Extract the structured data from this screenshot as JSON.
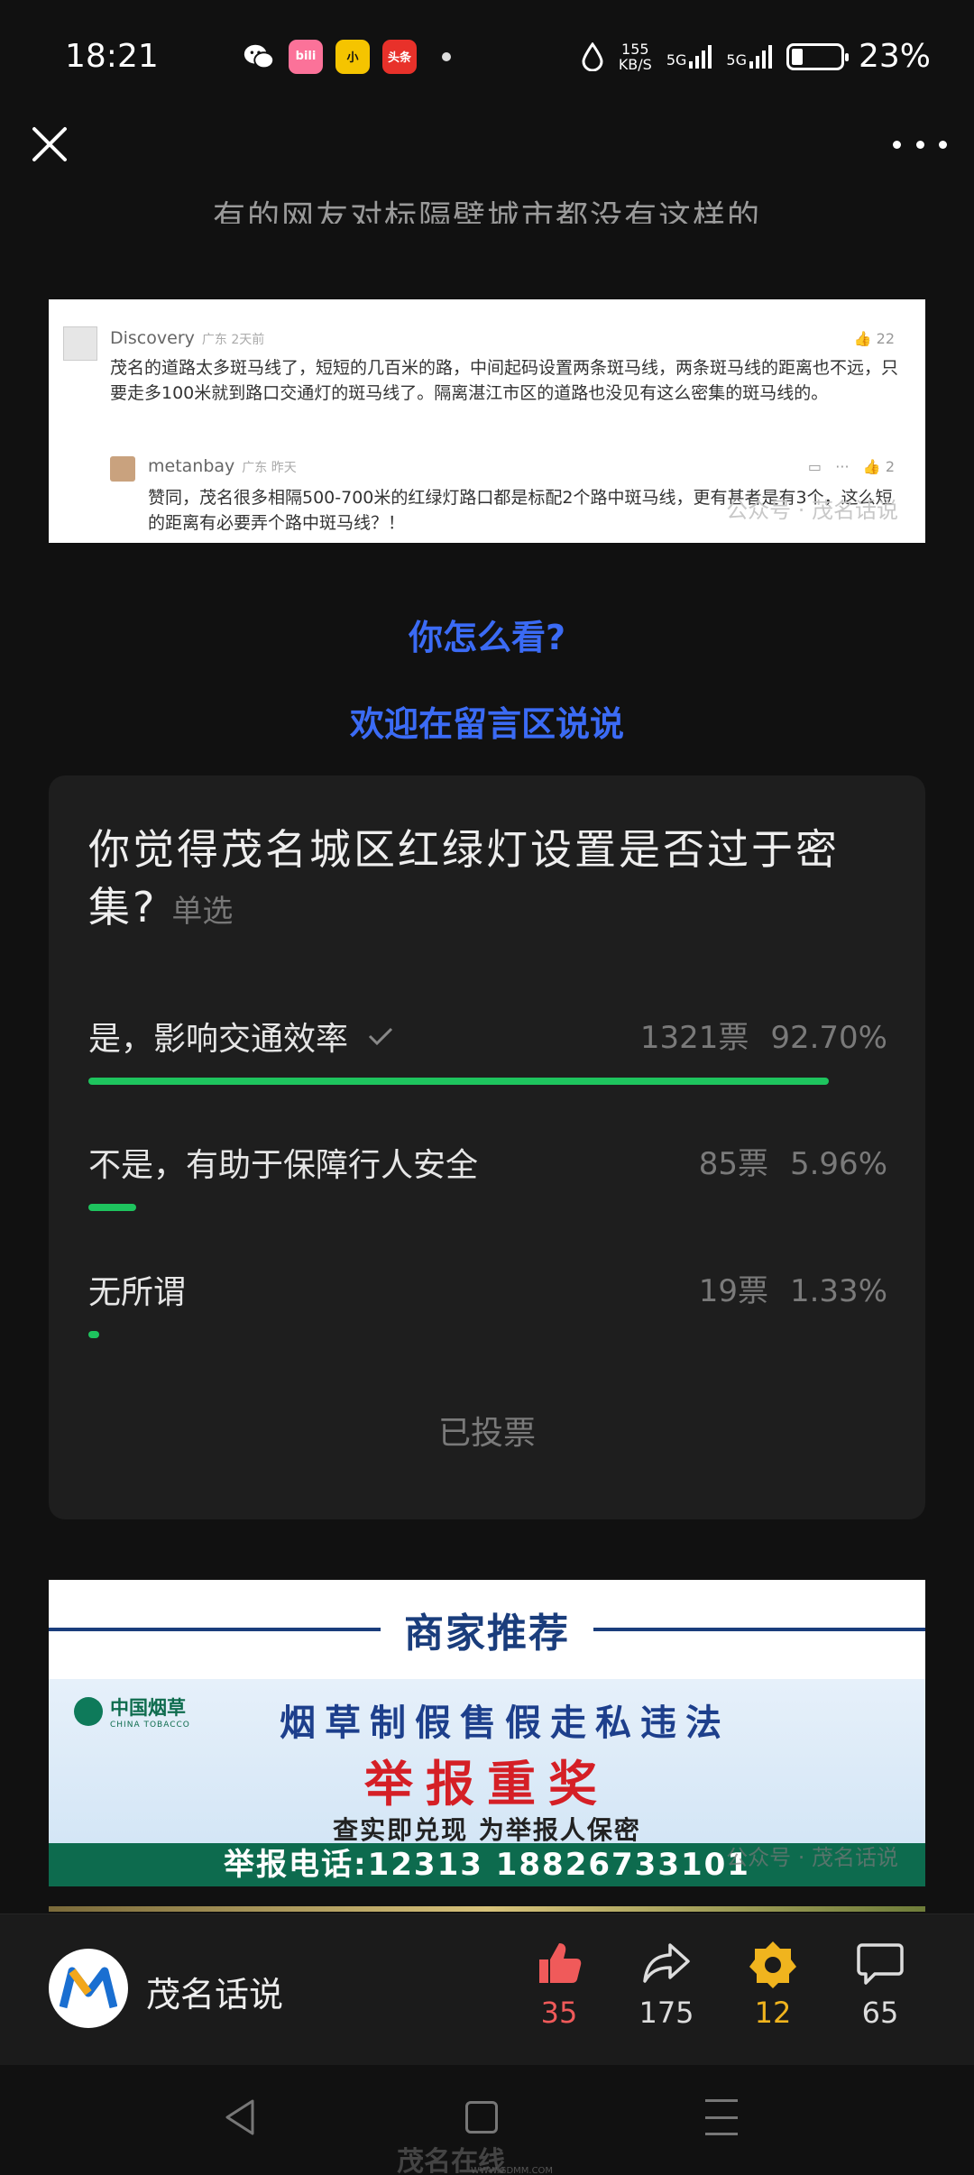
{
  "status_bar": {
    "time": "18:21",
    "apps": [
      "wechat-icon",
      "bilibili-icon",
      "diandian-icon",
      "toutiao-icon"
    ],
    "app_labels": {
      "bilibili": "bili",
      "diandian": "小",
      "toutiao": "头条"
    },
    "net_speed_value": "155",
    "net_speed_unit": "KB/S",
    "signal1_label": "5G",
    "signal2_label": "5G",
    "battery": "23%",
    "battery_level": 0.23
  },
  "article": {
    "cut_off_text": "有的网友对标隔壁城市都没有这样的",
    "question": "你怎么看?",
    "invite": "欢迎在留言区说说"
  },
  "comment_screenshot": {
    "comment": {
      "user": "Discovery",
      "meta": "广东  2天前",
      "likes": "22",
      "text": "茂名的道路太多斑马线了，短短的几百米的路，中间起码设置两条斑马线，两条斑马线的距离也不远，只要走多100米就到路口交通灯的斑马线了。隔离湛江市区的道路也没见有这么密集的斑马线的。"
    },
    "reply": {
      "user": "metanbay",
      "meta": "广东  昨天",
      "likes": "2",
      "text": "赞同，茂名很多相隔500-700米的红绿灯路口都是标配2个路中斑马线，更有甚者是有3个，这么短的距离有必要弄个路中斑马线？！"
    },
    "watermark": "公众号 · 茂名话说"
  },
  "poll": {
    "title": "你觉得茂名城区红绿灯设置是否过于密集?",
    "type": "单选",
    "options": [
      {
        "label": "是，影响交通效率",
        "votes": "1321票",
        "percent": "92.70%",
        "fraction": 0.927,
        "selected": true
      },
      {
        "label": "不是，有助于保障行人安全",
        "votes": "85票",
        "percent": "5.96%",
        "fraction": 0.0596,
        "selected": false
      },
      {
        "label": "无所谓",
        "votes": "19票",
        "percent": "1.33%",
        "fraction": 0.0133,
        "selected": false
      }
    ],
    "status": "已投票",
    "bar_color": "#1ec45e"
  },
  "ad": {
    "header": "商家推荐",
    "logo_cn": "中国烟草",
    "logo_en": "CHINA TOBACCO",
    "line1": "烟草制假售假走私违法",
    "line2": "举报重奖",
    "line3": "查实即兑现  为举报人保密",
    "hotline": "举报电话:12313  18826733101",
    "watermark": "公众号 · 茂名话说"
  },
  "bottom_bar": {
    "account_name": "茂名话说",
    "like_count": "35",
    "share_count": "175",
    "wow_count": "12",
    "comment_count": "65",
    "like_color": "#f05a5a",
    "wow_color": "#f0b41e"
  },
  "nav_bar": {
    "site_mark": "茂名在线",
    "site_url": "WWW.GDMM.COM"
  }
}
